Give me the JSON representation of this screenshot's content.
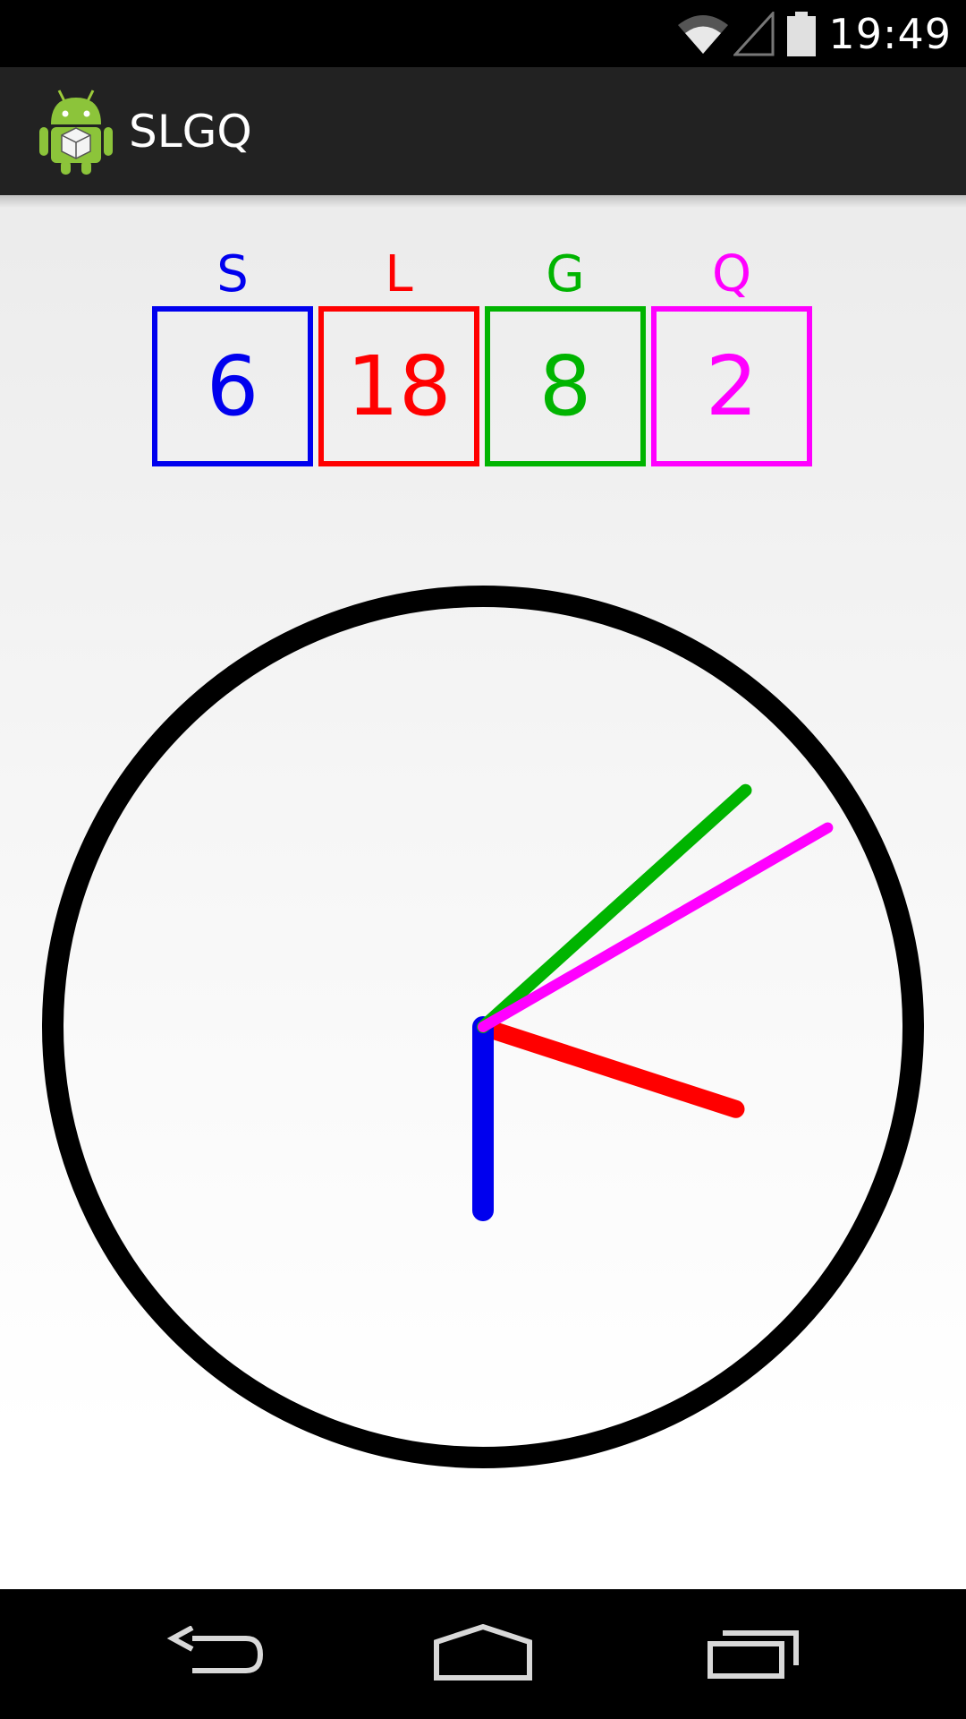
{
  "status_bar": {
    "time": "19:49",
    "icons": [
      "wifi-icon",
      "cell-signal-icon",
      "battery-icon"
    ]
  },
  "action_bar": {
    "title": "SLGQ",
    "icon": "android-robot-icon"
  },
  "counters": [
    {
      "label": "S",
      "value": "6",
      "color": "#0000ee"
    },
    {
      "label": "L",
      "value": "18",
      "color": "#ff0000"
    },
    {
      "label": "G",
      "value": "8",
      "color": "#00b400"
    },
    {
      "label": "Q",
      "value": "2",
      "color": "#ff00ff"
    }
  ],
  "clock": {
    "dial_color": "#000000",
    "hands": [
      {
        "name": "S",
        "color": "#0000ee",
        "value": 6
      },
      {
        "name": "L",
        "color": "#ff0000",
        "value": 18
      },
      {
        "name": "G",
        "color": "#00b400",
        "value": 8
      },
      {
        "name": "Q",
        "color": "#ff00ff",
        "value": 2
      }
    ]
  },
  "nav_bar": {
    "buttons": [
      "back-icon",
      "home-icon",
      "recent-apps-icon"
    ]
  }
}
